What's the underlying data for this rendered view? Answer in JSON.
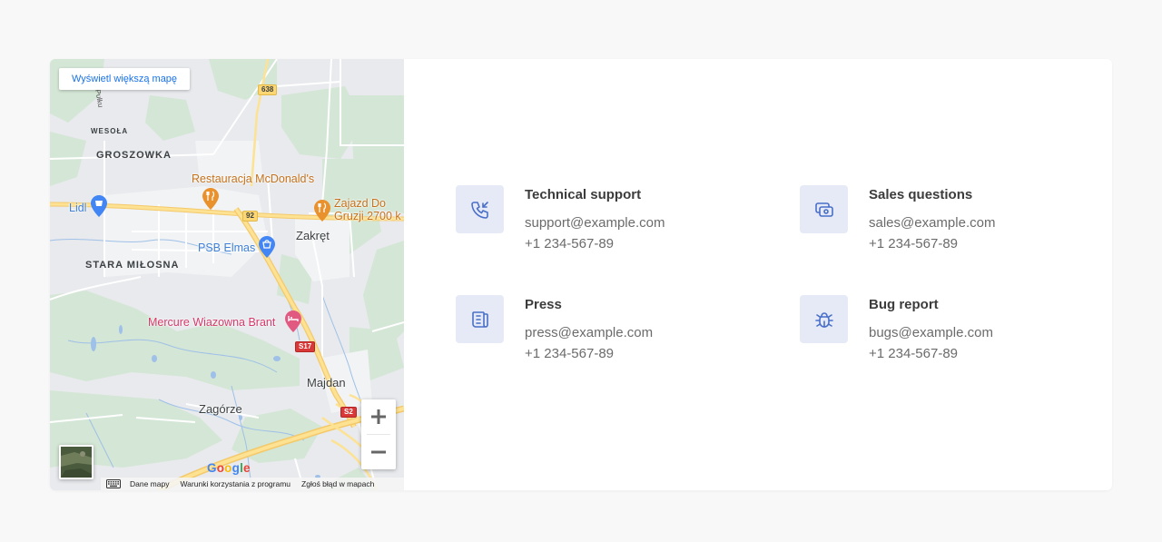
{
  "map": {
    "larger_map_link": "Wyświetl większą mapę",
    "labels": {
      "street": "go Pułku",
      "wesola": "WESOŁA",
      "groszowka": "GROSZOWKA",
      "stara_milosna": "STARA MIŁOSNA",
      "zakret": "Zakręt",
      "majdan": "Majdan",
      "zagorze": "Zagórze",
      "lidl": "Lidl",
      "mcdonalds": "Restauracja McDonald's",
      "zajazd_line1": "Zajazd Do",
      "zajazd_line2": "Gruzji 2700 k",
      "psb": "PSB Elmas",
      "mercure": "Mercure Wiazowna Brant"
    },
    "road_shields": {
      "r638": "638",
      "r92": "92",
      "s17": "S17",
      "s2": "S2"
    },
    "zoom_in_icon": "plus-icon",
    "zoom_out_icon": "minus-icon",
    "google_logo": [
      "G",
      "o",
      "o",
      "g",
      "l",
      "e"
    ],
    "google_logo_colors": [
      "#4285F4",
      "#EA4335",
      "#FBBC05",
      "#4285F4",
      "#34A853",
      "#EA4335"
    ],
    "attribution": {
      "keyboard_icon": "keyboard-icon",
      "map_data": "Dane mapy",
      "terms": "Warunki korzystania z programu",
      "report": "Zgłoś błąd w mapach"
    }
  },
  "contacts": [
    {
      "icon": "phone-incoming-icon",
      "title": "Technical support",
      "email": "support@example.com",
      "phone": "+1 234-567-89"
    },
    {
      "icon": "cash-icon",
      "title": "Sales questions",
      "email": "sales@example.com",
      "phone": "+1 234-567-89"
    },
    {
      "icon": "newspaper-icon",
      "title": "Press",
      "email": "press@example.com",
      "phone": "+1 234-567-89"
    },
    {
      "icon": "bug-icon",
      "title": "Bug report",
      "email": "bugs@example.com",
      "phone": "+1 234-567-89"
    }
  ],
  "colors": {
    "page_bg": "#f8f8f8",
    "icon_tile_bg": "#e5eaf6",
    "icon_stroke": "#4a6fc9",
    "title_text": "#3c3c3c",
    "body_text": "#6b6b6b",
    "map_link": "#1a73e8"
  }
}
